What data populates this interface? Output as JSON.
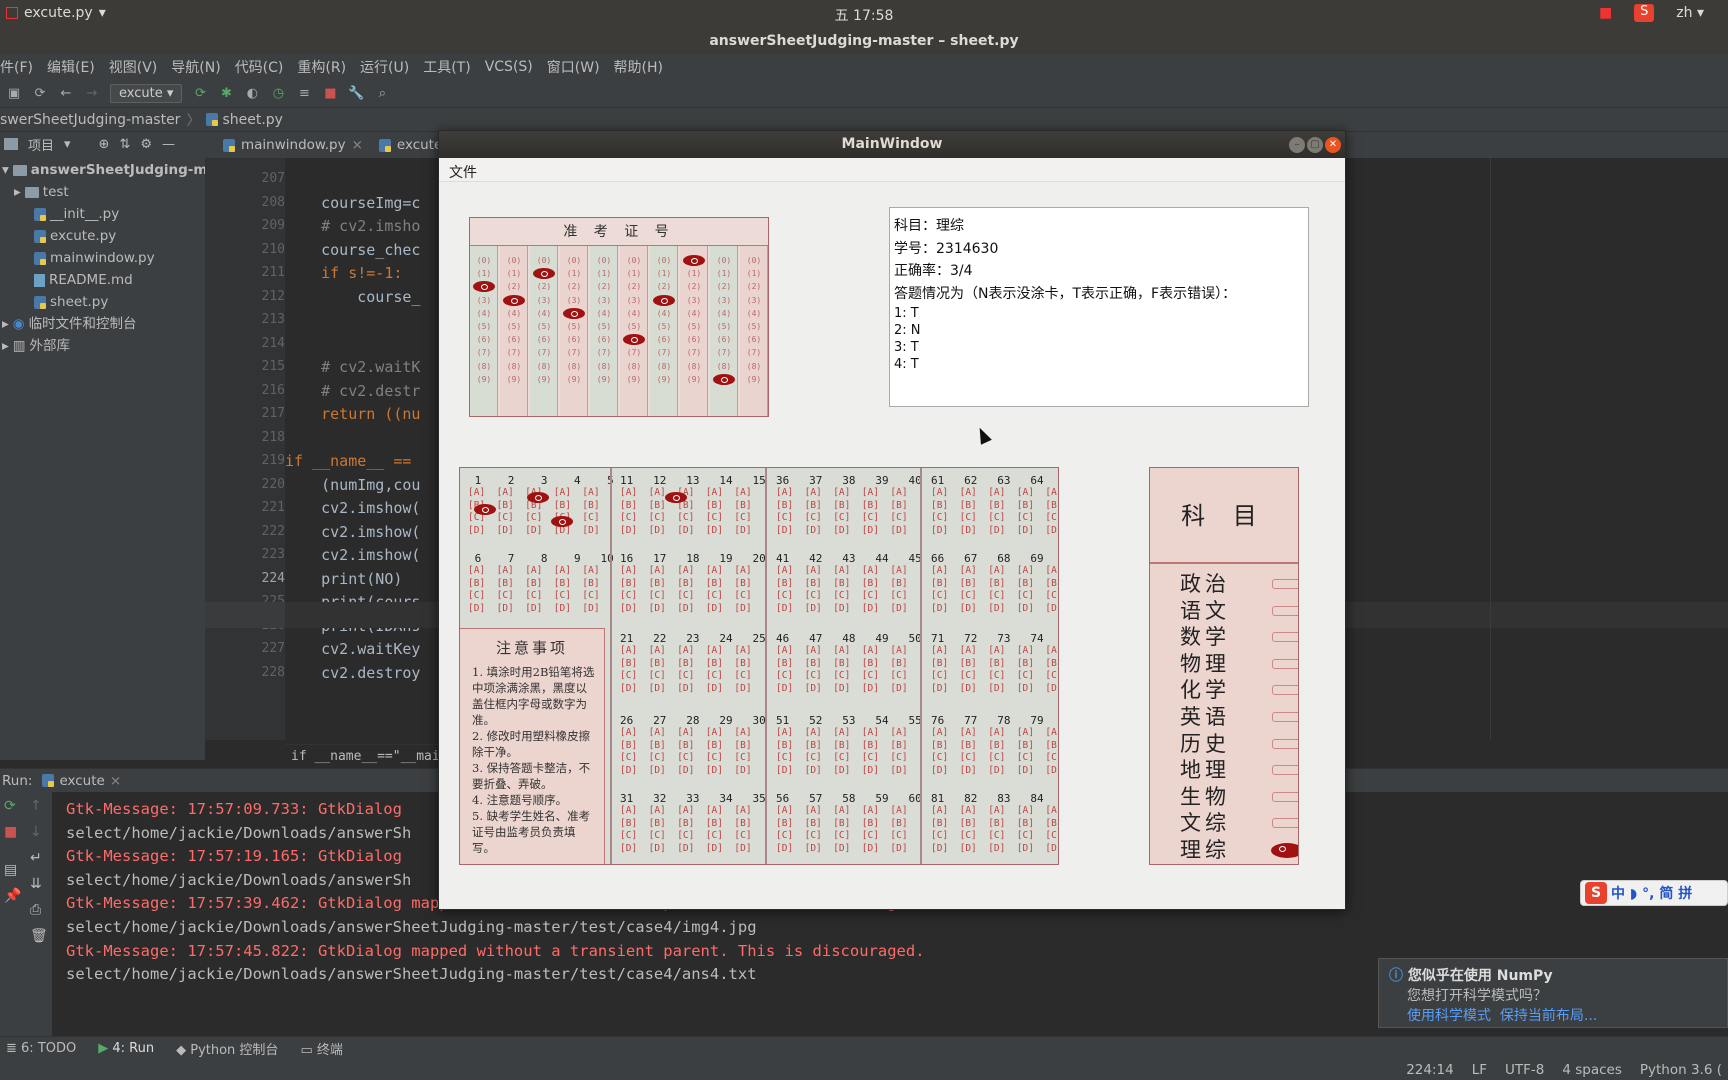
{
  "topbar": {
    "app_name": "excute.py",
    "clock": "五 17:58",
    "lang": "zh"
  },
  "window_title": "answerSheetJudging-master – sheet.py",
  "menu": [
    "件(F)",
    "编辑(E)",
    "视图(V)",
    "导航(N)",
    "代码(C)",
    "重构(R)",
    "运行(U)",
    "工具(T)",
    "VCS(S)",
    "窗口(W)",
    "帮助(H)"
  ],
  "toolbar": {
    "run_config": "excute"
  },
  "navbar": {
    "project": "swerSheetJudging-master",
    "file": "sheet.py"
  },
  "project_panel": {
    "title": "项目",
    "items": [
      {
        "label": "answerSheetJudging-ma",
        "type": "folder"
      },
      {
        "label": "test",
        "type": "folder"
      },
      {
        "label": "__init__.py",
        "type": "py"
      },
      {
        "label": "excute.py",
        "type": "py"
      },
      {
        "label": "mainwindow.py",
        "type": "py"
      },
      {
        "label": "README.md",
        "type": "md"
      },
      {
        "label": "sheet.py",
        "type": "py"
      },
      {
        "label": "临时文件和控制台",
        "type": "folder"
      },
      {
        "label": "外部库",
        "type": "folder"
      }
    ]
  },
  "editor_tabs": [
    "mainwindow.py",
    "excute"
  ],
  "line_numbers": [
    "207",
    "208",
    "209",
    "210",
    "211",
    "212",
    "213",
    "214",
    "215",
    "216",
    "217",
    "218",
    "219",
    "220",
    "221",
    "222",
    "223",
    "224",
    "225",
    "226",
    "227",
    "228"
  ],
  "code_lines": [
    "",
    "    courseImg=c",
    "    # cv2.imsho",
    "    course_chec",
    "    if s!=-1:",
    "        course_",
    "",
    "",
    "    # cv2.waitK",
    "    # cv2.destr",
    "    return ((nu",
    "",
    "if __name__ ==",
    "    (numImg,cou",
    "    cv2.imshow(",
    "    cv2.imshow(",
    "    cv2.imshow(",
    "    print(NO)",
    "    print(cours",
    "    print(IDAns",
    "    cv2.waitKey",
    "    cv2.destroy"
  ],
  "editor_breadcrumb": "if __name__==\"__mai",
  "run_panel": {
    "label": "Run:",
    "tab": "excute",
    "lines": [
      {
        "text": "Gtk-Message: 17:57:09.733: GtkDialog",
        "kind": "err"
      },
      {
        "text": "select/home/jackie/Downloads/answerSh",
        "kind": "ok"
      },
      {
        "text": "Gtk-Message: 17:57:19.165: GtkDialog",
        "kind": "err"
      },
      {
        "text": "select/home/jackie/Downloads/answerSh",
        "kind": "ok"
      },
      {
        "text": "Gtk-Message: 17:57:39.462: GtkDialog mapped without a transient parent. This is discouraged.",
        "kind": "err"
      },
      {
        "text": "select/home/jackie/Downloads/answerSheetJudging-master/test/case4/img4.jpg",
        "kind": "ok"
      },
      {
        "text": "Gtk-Message: 17:57:45.822: GtkDialog mapped without a transient parent. This is discouraged.",
        "kind": "err"
      },
      {
        "text": "select/home/jackie/Downloads/answerSheetJudging-master/test/case4/ans4.txt",
        "kind": "ok"
      }
    ]
  },
  "bottom_tabs": [
    "6: TODO",
    "4: Run",
    "Python 控制台",
    "终端"
  ],
  "status": [
    "224:14",
    "LF",
    "UTF-8",
    "4 spaces",
    "Python 3.6 ("
  ],
  "notification": {
    "title": "您似乎在使用 NumPy",
    "body": "您想打开科学模式吗？",
    "action1": "使用科学模式",
    "action2": "保持当前布局..."
  },
  "ime": {
    "text": "中 ◗ °, 简 拼"
  },
  "mainwindow": {
    "title": "MainWindow",
    "menu": "文件",
    "info": {
      "subject": "科目：理综",
      "student_id": "学号：2314630",
      "accuracy": "正确率：3/4",
      "legend": "答题情况为（N表示没涂卡，T表示正确，F表示错误）：",
      "answers": [
        "1: T",
        "2: N",
        "3: T",
        "4: T"
      ]
    },
    "id_card": {
      "header": "准 考 证 号"
    },
    "notes": {
      "title": "注意事项",
      "items": [
        "1. 填涂时用2B铅笔将选中项涂满涂黑，黑度以盖住框内字母或数字为准。",
        "2. 修改时用塑料橡皮擦除干净。",
        "3. 保持答题卡整洁，不要折叠、弄破。",
        "4. 注意题号顺序。",
        "5. 缺考学生姓名、准考证号由监考员负责填写。"
      ]
    },
    "subject_card": {
      "header": "科 目",
      "subjects": [
        "政治",
        "语文",
        "数学",
        "物理",
        "化学",
        "英语",
        "历史",
        "地理",
        "生物",
        "文综",
        "理综"
      ]
    }
  }
}
